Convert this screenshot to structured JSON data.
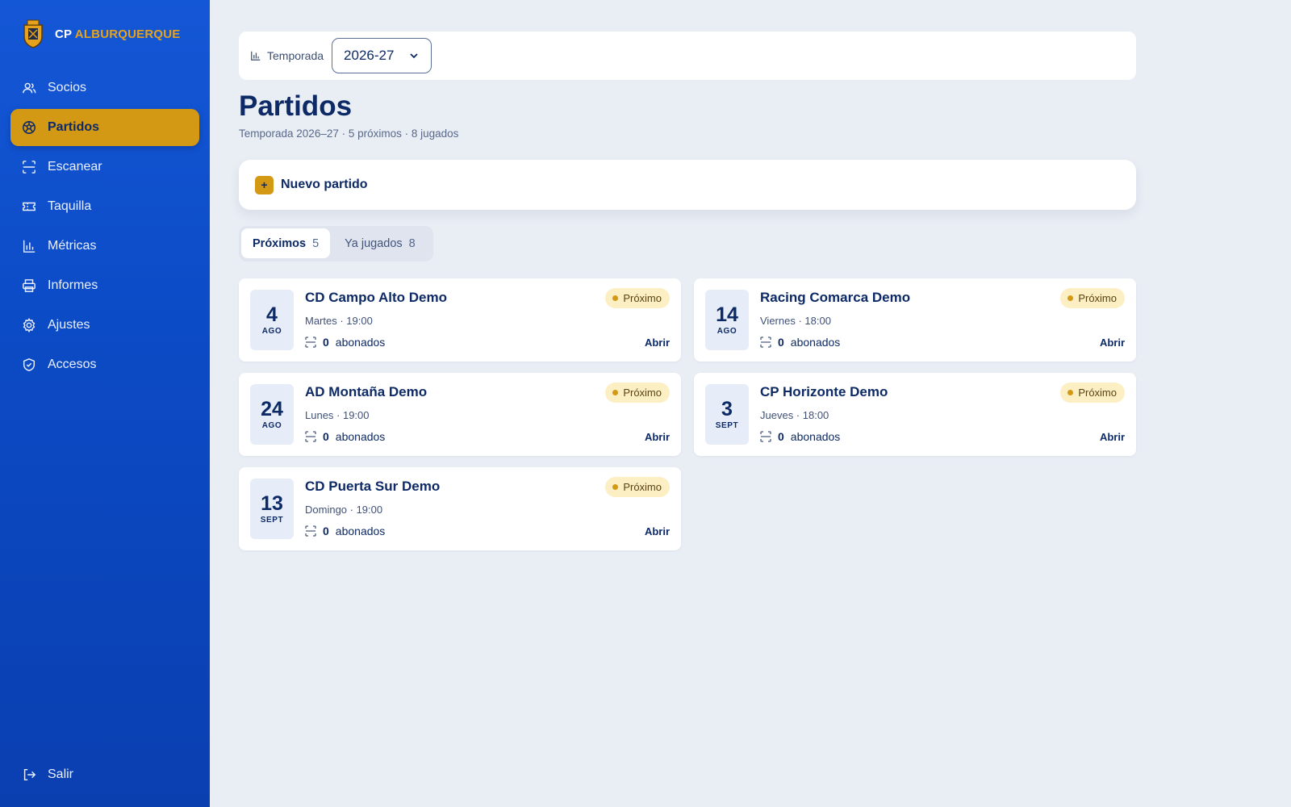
{
  "brand": {
    "prefix": "CP",
    "name": "ALBURQUERQUE",
    "accent_color": "#e5a21a"
  },
  "sidebar": {
    "items": [
      {
        "label": "Socios",
        "icon": "users-icon"
      },
      {
        "label": "Partidos",
        "icon": "soccer-ball-icon",
        "active": true
      },
      {
        "label": "Escanear",
        "icon": "scan-icon"
      },
      {
        "label": "Taquilla",
        "icon": "ticket-icon"
      },
      {
        "label": "Métricas",
        "icon": "bar-chart-icon"
      },
      {
        "label": "Informes",
        "icon": "printer-icon"
      },
      {
        "label": "Ajustes",
        "icon": "gear-icon"
      },
      {
        "label": "Accesos",
        "icon": "shield-icon"
      }
    ],
    "logout_label": "Salir",
    "active_color": "#d39914"
  },
  "season": {
    "label": "Temporada",
    "value": "2026-27"
  },
  "page": {
    "title": "Partidos",
    "subtitle": "Temporada 2026–27 · 5 próximos · 8 jugados"
  },
  "new_match": {
    "label": "Nuevo partido",
    "plus": "+"
  },
  "tabs": [
    {
      "label": "Próximos",
      "count": "5",
      "active": true
    },
    {
      "label": "Ya jugados",
      "count": "8"
    }
  ],
  "matches": [
    {
      "day": "4",
      "month": "AGO",
      "title": "CD Campo Alto Demo",
      "when": "Martes · 19:00",
      "abonados": "0",
      "abonados_label": "abonados",
      "status": "Próximo",
      "action": "Abrir"
    },
    {
      "day": "14",
      "month": "AGO",
      "title": "Racing Comarca Demo",
      "when": "Viernes · 18:00",
      "abonados": "0",
      "abonados_label": "abonados",
      "status": "Próximo",
      "action": "Abrir"
    },
    {
      "day": "24",
      "month": "AGO",
      "title": "AD Montaña Demo",
      "when": "Lunes · 19:00",
      "abonados": "0",
      "abonados_label": "abonados",
      "status": "Próximo",
      "action": "Abrir"
    },
    {
      "day": "3",
      "month": "SEPT",
      "title": "CP Horizonte Demo",
      "when": "Jueves · 18:00",
      "abonados": "0",
      "abonados_label": "abonados",
      "status": "Próximo",
      "action": "Abrir"
    },
    {
      "day": "13",
      "month": "SEPT",
      "title": "CD Puerta Sur Demo",
      "when": "Domingo · 19:00",
      "abonados": "0",
      "abonados_label": "abonados",
      "status": "Próximo",
      "action": "Abrir"
    }
  ]
}
